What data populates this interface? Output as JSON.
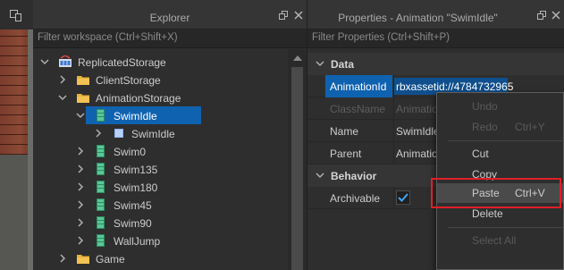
{
  "explorer": {
    "title": "Explorer",
    "filter_placeholder": "Filter workspace (Ctrl+Shift+X)",
    "tree": [
      {
        "label": "ReplicatedStorage",
        "icon": "replicated-storage-icon",
        "expanded": true
      },
      {
        "label": "ClientStorage",
        "icon": "folder-icon",
        "expanded": false
      },
      {
        "label": "AnimationStorage",
        "icon": "folder-icon",
        "expanded": true
      },
      {
        "label": "SwimIdle",
        "icon": "animation-icon",
        "expanded": true,
        "selected": true
      },
      {
        "label": "SwimIdle",
        "icon": "keyframe-sequence-icon",
        "expanded": false
      },
      {
        "label": "Swim0",
        "icon": "animation-icon",
        "expanded": false
      },
      {
        "label": "Swim135",
        "icon": "animation-icon",
        "expanded": false
      },
      {
        "label": "Swim180",
        "icon": "animation-icon",
        "expanded": false
      },
      {
        "label": "Swim45",
        "icon": "animation-icon",
        "expanded": false
      },
      {
        "label": "Swim90",
        "icon": "animation-icon",
        "expanded": false
      },
      {
        "label": "WallJump",
        "icon": "animation-icon",
        "expanded": false
      },
      {
        "label": "Game",
        "icon": "folder-icon",
        "expanded": false
      }
    ]
  },
  "properties": {
    "title": "Properties - Animation \"SwimIdle\"",
    "filter_placeholder": "Filter Properties (Ctrl+Shift+P)",
    "sections": {
      "data": "Data",
      "behavior": "Behavior"
    },
    "rows": {
      "animation_id": {
        "name": "AnimationId",
        "value": "rbxassetid://4784732965"
      },
      "class_name": {
        "name": "ClassName",
        "value": "Animation"
      },
      "name": {
        "name": "Name",
        "value": "SwimIdle"
      },
      "parent": {
        "name": "Parent",
        "value": "AnimationStorage"
      },
      "archivable": {
        "name": "Archivable",
        "checked": true
      }
    }
  },
  "context_menu": {
    "items": [
      {
        "label": "Undo",
        "shortcut": "",
        "enabled": false
      },
      {
        "label": "Redo",
        "shortcut": "Ctrl+Y",
        "enabled": false
      },
      {
        "label": "Cut",
        "shortcut": "",
        "enabled": true
      },
      {
        "label": "Copy",
        "shortcut": "",
        "enabled": true
      },
      {
        "label": "Paste",
        "shortcut": "Ctrl+V",
        "enabled": true,
        "highlighted": true
      },
      {
        "label": "Delete",
        "shortcut": "",
        "enabled": true
      },
      {
        "label": "Select All",
        "shortcut": "",
        "enabled": false
      }
    ]
  },
  "colors": {
    "selection": "#0f62b0",
    "highlight_box": "#e01f28",
    "folder": "#e8b13a",
    "animation_icon": "#3fae7e",
    "checkmark": "#3fa5f5"
  }
}
